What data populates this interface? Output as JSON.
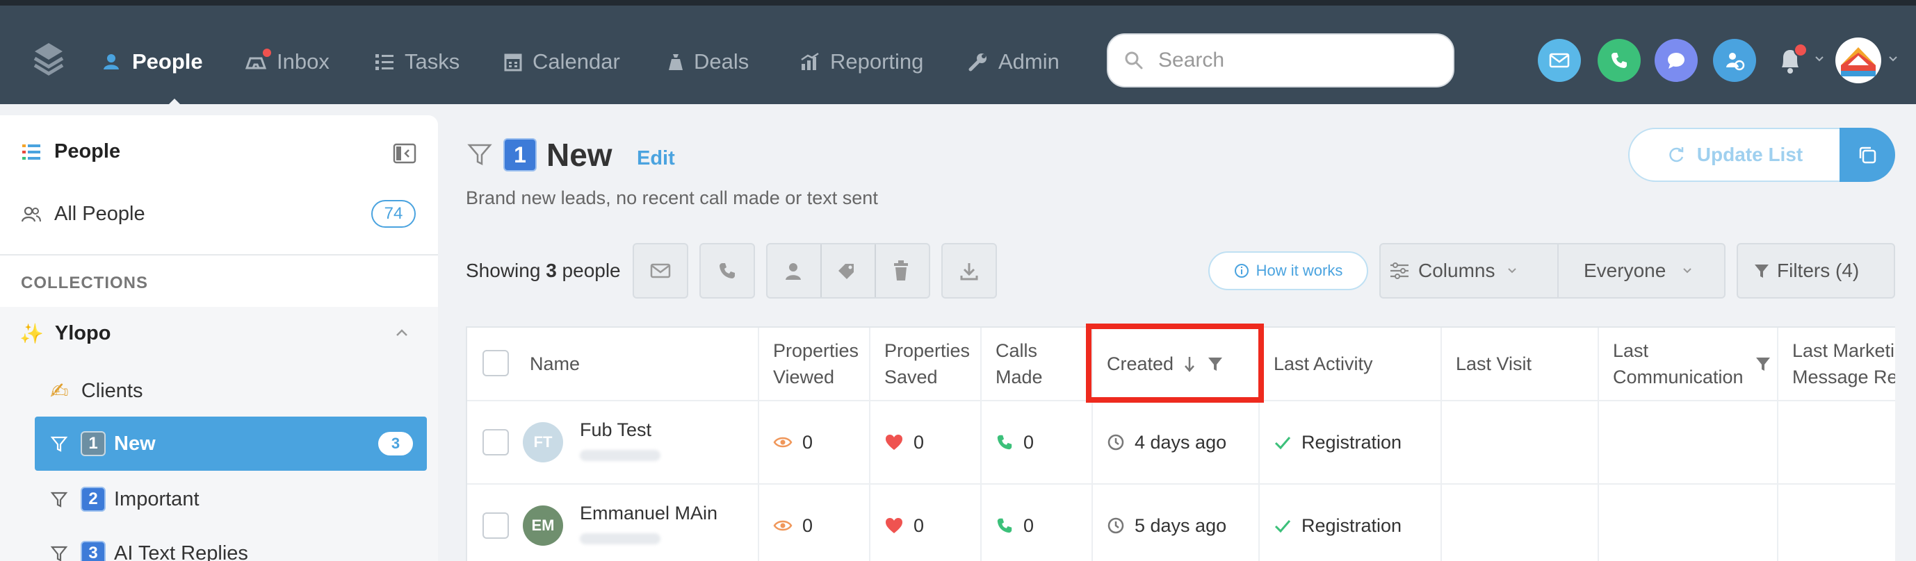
{
  "nav": {
    "items": [
      {
        "label": "People",
        "icon": "people-icon"
      },
      {
        "label": "Inbox",
        "icon": "inbox-icon"
      },
      {
        "label": "Tasks",
        "icon": "tasks-icon"
      },
      {
        "label": "Calendar",
        "icon": "calendar-icon"
      },
      {
        "label": "Deals",
        "icon": "deals-icon"
      },
      {
        "label": "Reporting",
        "icon": "reporting-icon"
      },
      {
        "label": "Admin",
        "icon": "wrench-icon"
      }
    ],
    "search_placeholder": "Search"
  },
  "colors": {
    "topbar": "#3a4a58",
    "accent": "#4aa3df",
    "highlight": "#ee2a1e",
    "email": "#5ab8e8",
    "phone": "#3cc07a",
    "chat": "#7b8cf0",
    "integration": "#4aa3df"
  },
  "sidebar": {
    "title": "People",
    "all_people_label": "All People",
    "all_people_count": "74",
    "collections_label": "COLLECTIONS",
    "group_label": "Ylopo",
    "items": [
      {
        "label": "Clients",
        "prefix": "✍️"
      },
      {
        "label": "New",
        "key": "1",
        "count": "3"
      },
      {
        "label": "Important",
        "key": "2"
      },
      {
        "label": "AI Text Replies",
        "key": "3"
      }
    ]
  },
  "main": {
    "list_key": "1",
    "list_title": "New",
    "edit_label": "Edit",
    "subtitle": "Brand new leads, no recent call made or text sent",
    "update_label": "Update List",
    "showing_prefix": "Showing",
    "showing_count": "3",
    "showing_suffix": "people",
    "how_it_works": "How it works",
    "columns_label": "Columns",
    "everyone_label": "Everyone",
    "filters_label": "Filters (4)"
  },
  "table": {
    "headers": {
      "name": "Name",
      "viewed_1": "Properties",
      "viewed_2": "Viewed",
      "saved_1": "Properties",
      "saved_2": "Saved",
      "calls_1": "Calls",
      "calls_2": "Made",
      "created": "Created",
      "last_activity": "Last Activity",
      "last_visit": "Last Visit",
      "last_comm_1": "Last",
      "last_comm_2": "Communication",
      "last_mkt_1": "Last Marketi",
      "last_mkt_2": "Message Re"
    },
    "rows": [
      {
        "initials": "FT",
        "name": "Fub Test",
        "viewed": "0",
        "saved": "0",
        "calls": "0",
        "created": "4 days ago",
        "activity": "Registration",
        "avatar_color": "#c9dbe6"
      },
      {
        "initials": "EM",
        "name": "Emmanuel MAin",
        "viewed": "0",
        "saved": "0",
        "calls": "0",
        "created": "5 days ago",
        "activity": "Registration",
        "avatar_color": "#6f8f6e"
      }
    ]
  }
}
